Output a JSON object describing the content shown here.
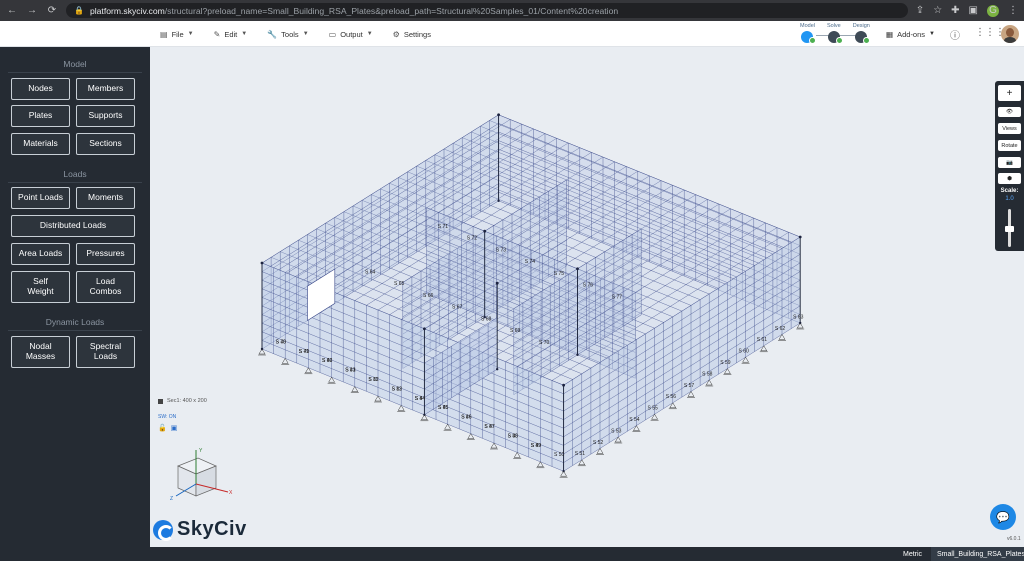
{
  "browser": {
    "url_host": "platform.skyciv.com",
    "url_path": "/structural?preload_name=Small_Building_RSA_Plates&preload_path=Structural%20Samples_01/Content%20creation",
    "profile_initial": "G"
  },
  "menu": {
    "file": "File",
    "edit": "Edit",
    "tools": "Tools",
    "output": "Output",
    "settings": "Settings",
    "addons": "Add-ons"
  },
  "steps": {
    "model": "Model",
    "solve": "Solve",
    "design": "Design"
  },
  "sidebar": {
    "model_title": "Model",
    "loads_title": "Loads",
    "dynamic_title": "Dynamic Loads",
    "nodes": "Nodes",
    "members": "Members",
    "plates": "Plates",
    "supports": "Supports",
    "materials": "Materials",
    "sections": "Sections",
    "point_loads": "Point Loads",
    "moments": "Moments",
    "distributed_loads": "Distributed Loads",
    "area_loads": "Area Loads",
    "pressures": "Pressures",
    "self_weight_1": "Self",
    "self_weight_2": "Weight",
    "load_combos_1": "Load",
    "load_combos_2": "Combos",
    "nodal_masses_1": "Nodal",
    "nodal_masses_2": "Masses",
    "spectral_loads_1": "Spectral",
    "spectral_loads_2": "Loads"
  },
  "canvas": {
    "section_label": "Sec1: 400 x 200",
    "sw_label": "SW: ON",
    "axis_x": "X",
    "axis_y": "Y",
    "axis_z": "Z",
    "wire_color": "#3b4a8a",
    "plate_color": "#b9c9e6",
    "node_color": "#1c2340",
    "plate_labels": [
      "S 40",
      "S 41",
      "S 42",
      "S 43",
      "S 11",
      "S 12",
      "S 44",
      "S 45",
      "S 46",
      "S 47",
      "S 48",
      "S 49",
      "S 50",
      "S 51",
      "S 52",
      "S 53",
      "S 54",
      "S 55",
      "S 56",
      "S 57",
      "S 58",
      "S 59",
      "S 60",
      "S 61",
      "S 62",
      "S 63",
      "S 64",
      "S 65",
      "S 66",
      "S 67",
      "S 68",
      "S 69",
      "S 70",
      "S 71",
      "S 72",
      "S 73",
      "S 74",
      "S 75",
      "S 76",
      "S 77",
      "S 78",
      "S 79",
      "S 80",
      "S 81",
      "S 82",
      "S 83",
      "S 84",
      "S 85",
      "S 86",
      "S 87",
      "S 88",
      "S 89"
    ]
  },
  "toolbar": {
    "plus": "+",
    "views": "Views",
    "rotate": "Rotate",
    "scale_label": "Scale:",
    "scale_value": "1.0"
  },
  "brand": {
    "logo_text": "SkyCiv"
  },
  "status": {
    "units": "Metric",
    "file_name": "Small_Building_RSA_Plates",
    "version": "v6.0.1"
  }
}
